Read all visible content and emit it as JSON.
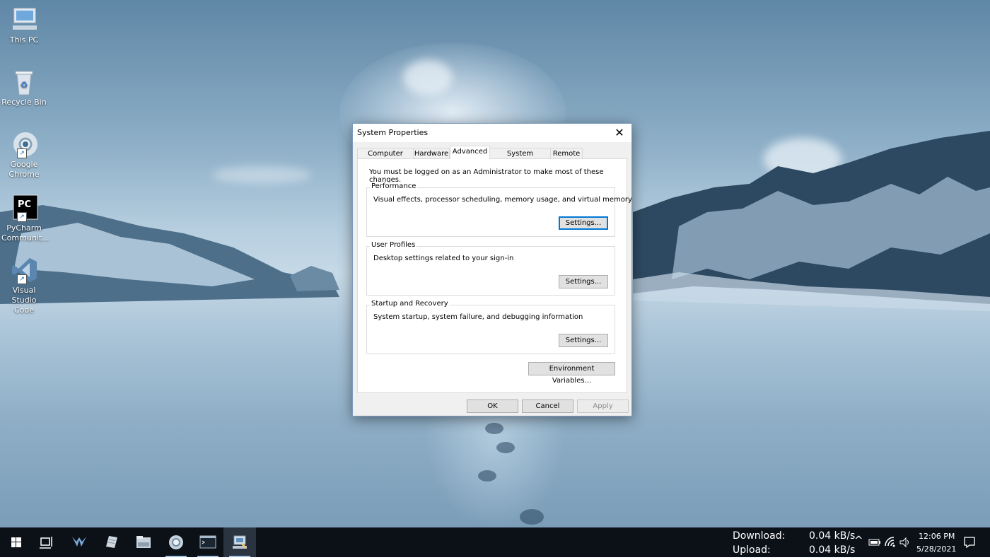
{
  "desktop": {
    "icons": [
      {
        "label": "This PC",
        "icon": "computer-icon"
      },
      {
        "label": "Recycle Bin",
        "icon": "recycle-bin-icon"
      },
      {
        "label": "Google Chrome",
        "icon": "chrome-icon"
      },
      {
        "label": "PyCharm Communit...",
        "icon": "pycharm-icon"
      },
      {
        "label": "Visual Studio Code",
        "icon": "vscode-icon"
      }
    ]
  },
  "dialog": {
    "title": "System Properties",
    "close_glyph": "✕",
    "tabs": [
      {
        "label": "Computer Name",
        "active": false
      },
      {
        "label": "Hardware",
        "active": false
      },
      {
        "label": "Advanced",
        "active": true
      },
      {
        "label": "System Protection",
        "active": false
      },
      {
        "label": "Remote",
        "active": false
      }
    ],
    "admin_note": "You must be logged on as an Administrator to make most of these changes.",
    "groups": [
      {
        "title": "Performance",
        "description": "Visual effects, processor scheduling, memory usage, and virtual memory",
        "button": "Settings..."
      },
      {
        "title": "User Profiles",
        "description": "Desktop settings related to your sign-in",
        "button": "Settings..."
      },
      {
        "title": "Startup and Recovery",
        "description": "System startup, system failure, and debugging information",
        "button": "Settings..."
      }
    ],
    "env_button": "Environment Variables...",
    "ok_button": "OK",
    "cancel_button": "Cancel",
    "apply_button": "Apply"
  },
  "taskbar": {
    "download_label": "Download:",
    "download_value": "0.04 kB/s",
    "upload_label": "Upload:",
    "upload_value": "0.04 kB/s",
    "time": "12:06 PM",
    "date": "5/28/2021",
    "tray_chevron": "^"
  },
  "colors": {
    "accent": "#0078d7",
    "taskbar": "#0c1118"
  }
}
